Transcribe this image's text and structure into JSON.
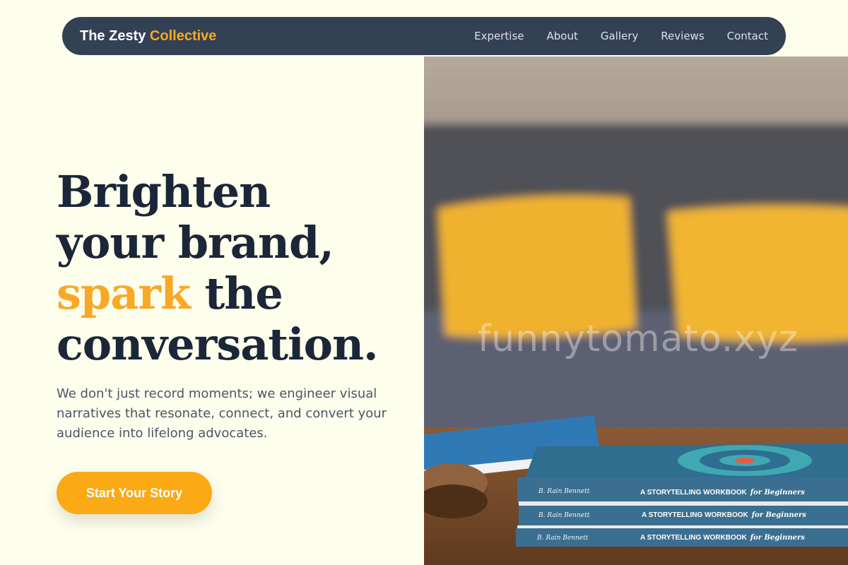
{
  "nav": {
    "brand_main": "The Zesty",
    "brand_accent": "Collective",
    "links": [
      "Expertise",
      "About",
      "Gallery",
      "Reviews",
      "Contact"
    ]
  },
  "hero": {
    "line1": "Brighten",
    "line2": "your brand,",
    "line3_accent": "spark",
    "line3_rest": " the",
    "line4": "conversation.",
    "subtext": "We don't just record moments; we engineer visual narratives that resonate, connect, and convert your audience into lifelong advocates.",
    "cta_label": "Start Your Story"
  },
  "photo": {
    "watermark": "funnytomato.xyz",
    "book_author": "B. Rain Bennett",
    "book_title_a": "A STORYTELLING WORKBOOK",
    "book_title_b": "for Beginners"
  },
  "colors": {
    "background": "#fefeec",
    "nav": "#334155",
    "accent": "#f9a825",
    "heading": "#1c2639",
    "cta": "#fba914"
  }
}
